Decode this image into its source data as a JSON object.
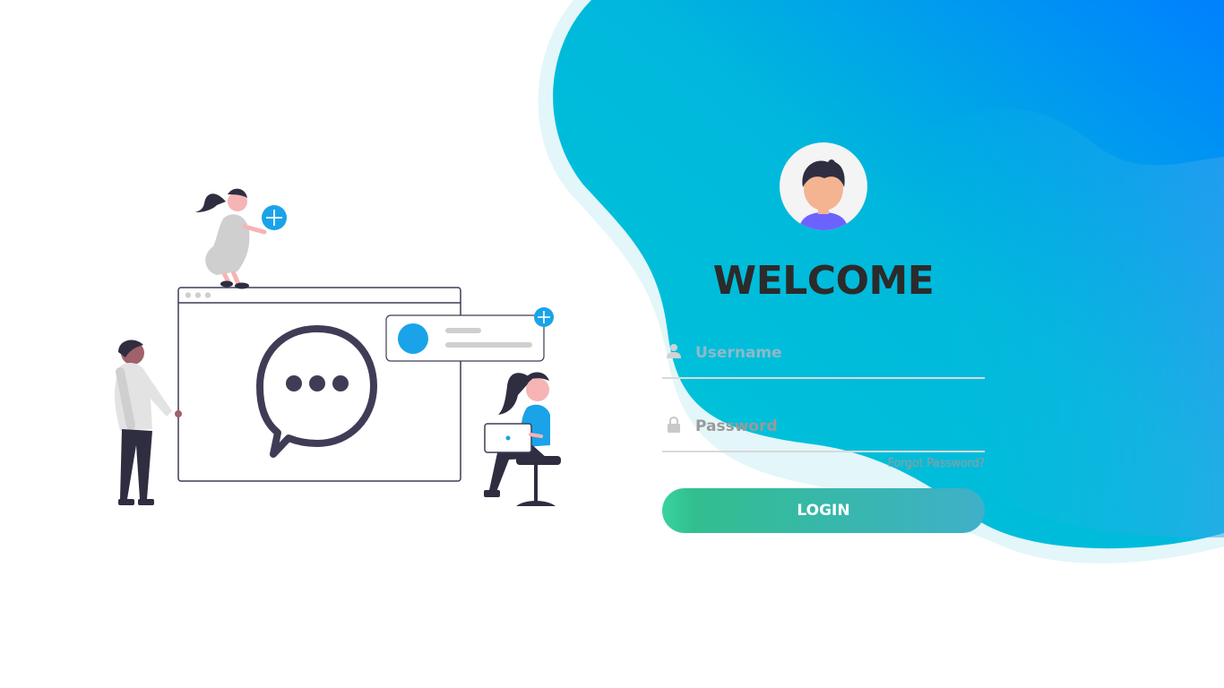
{
  "login": {
    "title": "WELCOME",
    "username_placeholder": "Username",
    "username_value": "",
    "password_placeholder": "Password",
    "password_value": "",
    "forgot_label": "Forgot Password?",
    "login_label": "LOGIN"
  },
  "icons": {
    "avatar": "user-avatar-icon",
    "username": "user-icon",
    "password": "lock-icon",
    "chat": "chat-bubble-icon",
    "add": "plus-circle-icon"
  },
  "colors": {
    "wave_start": "#00c6d8",
    "wave_end": "#0080ff",
    "button_start": "#32be8f",
    "button_end": "#3fb0c9",
    "accent": "#1aa3e8",
    "title": "#2b2b2b"
  }
}
